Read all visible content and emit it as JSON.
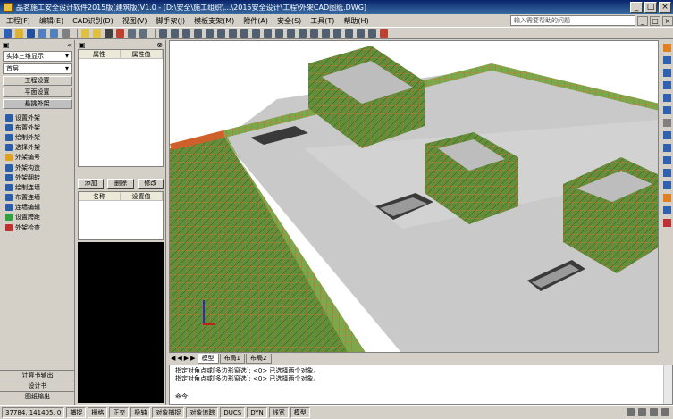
{
  "window": {
    "title": "品茗施工安全设计软件2015版(建筑版)V1.0 - [D:\\安全\\施工组织\\...\\2015安全设计\\工程\\外架CAD图纸.DWG]"
  },
  "menu": {
    "items": [
      "工程(F)",
      "编辑(E)",
      "CAD识别(D)",
      "视图(V)",
      "脚手架(J)",
      "模板支架(M)",
      "附件(A)",
      "安全(S)",
      "工具(T)",
      "帮助(H)"
    ],
    "search_placeholder": "输入需要帮助的问题"
  },
  "left_panel": {
    "view_combo": "实体三维显示",
    "floor_combo": "首层",
    "sections": [
      "工程设置",
      "平面设置",
      "悬挑外架"
    ],
    "items": [
      "设置外架",
      "布置外架",
      "绘制外架",
      "选择外架",
      "外架编号",
      "外架构造",
      "外架翻转",
      "绘制连墙",
      "布置连墙",
      "连墙编辑",
      "设置跨距",
      "外架检查"
    ],
    "bottom_buttons": [
      "计算书输出",
      "设计书",
      "图纸输出"
    ]
  },
  "mid_panel": {
    "grid1_headers": [
      "属性",
      "属性值"
    ],
    "buttons": [
      "添加",
      "删除",
      "修改"
    ],
    "grid2_headers": [
      "名称",
      "设置值"
    ]
  },
  "tabs": {
    "nav": [
      "◀",
      "◀",
      "▶",
      "▶"
    ],
    "items": [
      "模型",
      "布局1",
      "布局2"
    ]
  },
  "command": {
    "lines": [
      "指定对角点或[多边形窗选]:  <0>  已选择两个对象。",
      "指定对角点或[多边形窗选]:  <0>  已选择两个对象。"
    ],
    "prompt": "命令:"
  },
  "status": {
    "cells": [
      "37784, 141405, 0",
      "捕捉",
      "栅格",
      "正交",
      "极轴",
      "对象捕捉",
      "对象追踪",
      "DUCS",
      "DYN",
      "线宽",
      "模型"
    ]
  },
  "colors": {
    "scaffold_green": "#4a7a2a",
    "scaffold_orange": "#d0602a",
    "slab_gray": "#c8c8c8",
    "title_bar": "#0a246a"
  }
}
